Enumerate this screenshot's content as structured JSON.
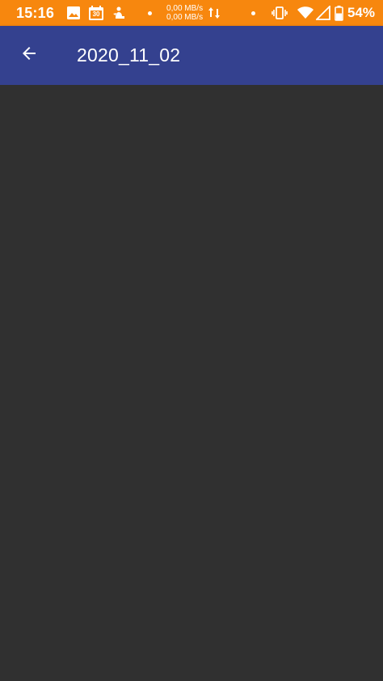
{
  "status_bar": {
    "time": "15:16",
    "net_up": "0,00 MB/s",
    "net_down": "0,00 MB/s",
    "battery_percent": "54%",
    "background": "#f7870e",
    "icons_left": [
      "image-icon",
      "calendar-icon",
      "notification-app-icon"
    ],
    "calendar_day": "30",
    "icons_right": [
      "vibrate-icon",
      "wifi-icon",
      "cell-signal-icon",
      "battery-icon"
    ]
  },
  "app_bar": {
    "title": "2020_11_02",
    "back_icon": "arrow-back-icon",
    "background": "#34418f"
  },
  "content": {
    "background": "#303030"
  }
}
